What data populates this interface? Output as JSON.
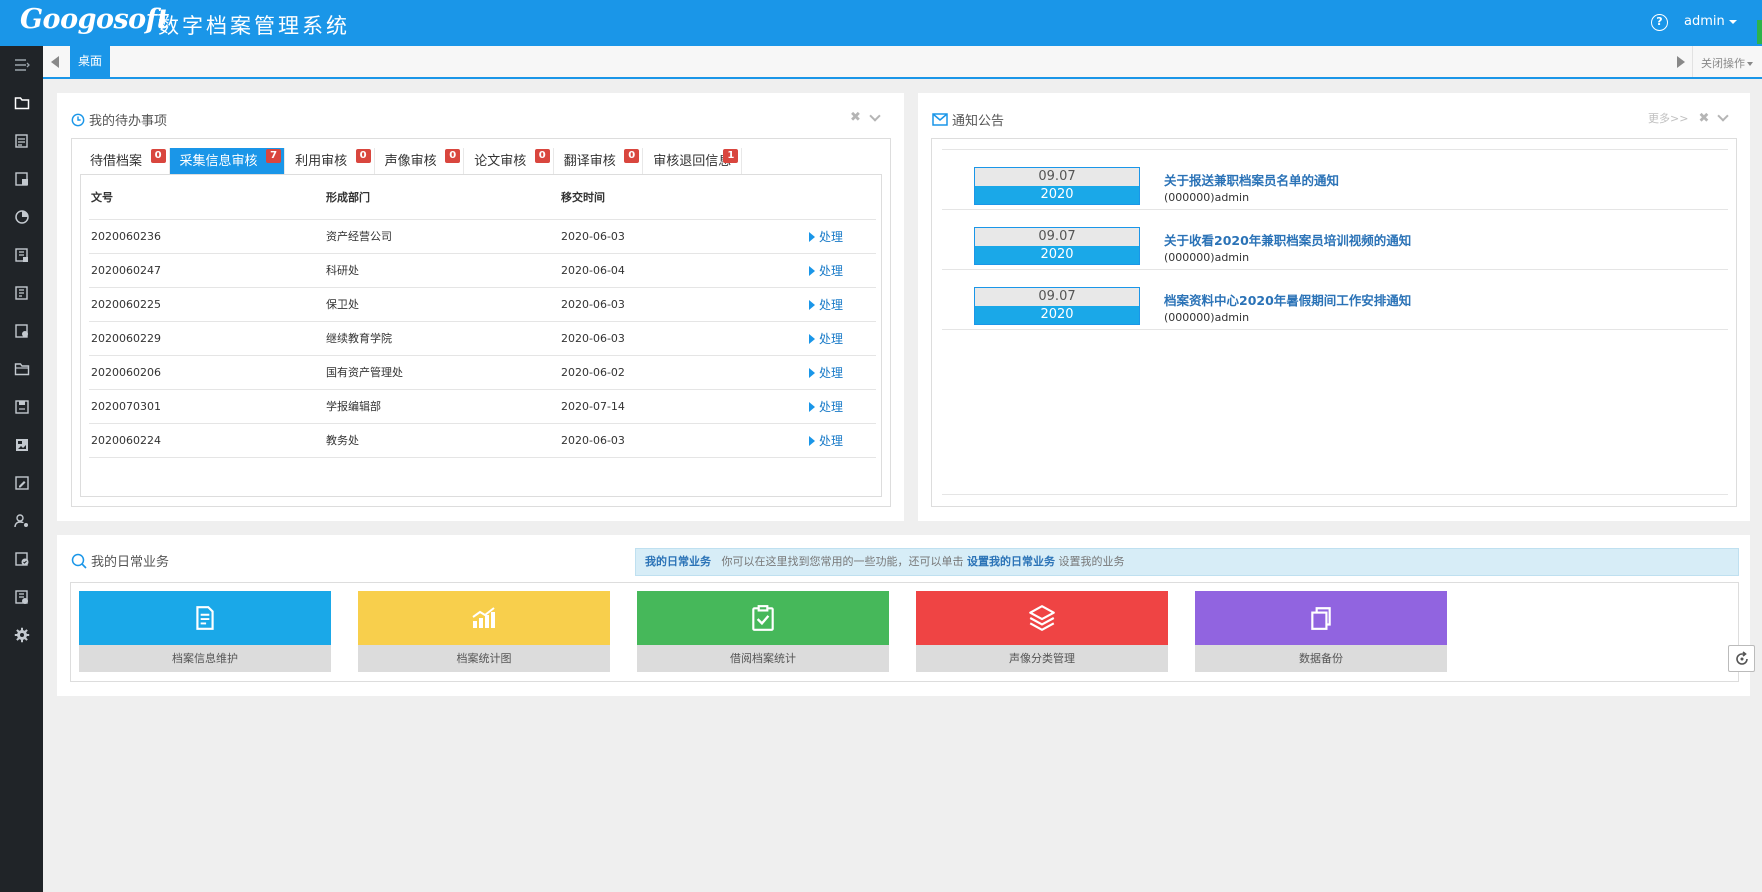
{
  "header": {
    "brand": "Googosoft",
    "system_name": "数字档案管理系统",
    "help_icon": "question-circle-icon",
    "user": "admin"
  },
  "tabbar": {
    "home_tab": "桌面",
    "close_ops": "关闭操作"
  },
  "todo": {
    "title": "我的待办事项",
    "tabs": [
      {
        "label": "待借档案",
        "count": "0"
      },
      {
        "label": "采集信息审核",
        "count": "7"
      },
      {
        "label": "利用审核",
        "count": "0"
      },
      {
        "label": "声像审核",
        "count": "0"
      },
      {
        "label": "论文审核",
        "count": "0"
      },
      {
        "label": "翻译审核",
        "count": "0"
      },
      {
        "label": "审核退回信息",
        "count": "1"
      }
    ],
    "active_tab": 1,
    "columns": {
      "doc_no": "文号",
      "dept": "形成部门",
      "time": "移交时间"
    },
    "rows": [
      {
        "doc_no": "2020060236",
        "dept": "资产经营公司",
        "time": "2020-06-03",
        "action": "处理"
      },
      {
        "doc_no": "2020060247",
        "dept": "科研处",
        "time": "2020-06-04",
        "action": "处理"
      },
      {
        "doc_no": "2020060225",
        "dept": "保卫处",
        "time": "2020-06-03",
        "action": "处理"
      },
      {
        "doc_no": "2020060229",
        "dept": "继续教育学院",
        "time": "2020-06-03",
        "action": "处理"
      },
      {
        "doc_no": "2020060206",
        "dept": "国有资产管理处",
        "time": "2020-06-02",
        "action": "处理"
      },
      {
        "doc_no": "2020070301",
        "dept": "学报编辑部",
        "time": "2020-07-14",
        "action": "处理"
      },
      {
        "doc_no": "2020060224",
        "dept": "教务处",
        "time": "2020-06-03",
        "action": "处理"
      }
    ]
  },
  "notice": {
    "title": "通知公告",
    "more": "更多>>",
    "items": [
      {
        "md": "09.07",
        "year": "2020",
        "title": "关于报送兼职档案员名单的通知",
        "author": "(000000)admin"
      },
      {
        "md": "09.07",
        "year": "2020",
        "title": "关于收看2020年兼职档案员培训视频的通知",
        "author": "(000000)admin"
      },
      {
        "md": "09.07",
        "year": "2020",
        "title": "档案资料中心2020年暑假期间工作安排通知",
        "author": "(000000)admin"
      }
    ]
  },
  "daily": {
    "title": "我的日常业务",
    "info_label": "我的日常业务",
    "info_text1": "你可以在这里找到您常用的一些功能，还可以单击",
    "info_link": "设置我的日常业务",
    "info_text2": "设置我的业务",
    "tiles": [
      {
        "label": "档案信息维护",
        "color": "#1aa8e8",
        "icon": "document-icon"
      },
      {
        "label": "档案统计图",
        "color": "#f8cf4c",
        "icon": "bar-chart-icon"
      },
      {
        "label": "借阅档案统计",
        "color": "#46b85a",
        "icon": "clipboard-check-icon"
      },
      {
        "label": "声像分类管理",
        "color": "#ef4444",
        "icon": "layers-icon"
      },
      {
        "label": "数据备份",
        "color": "#9164e0",
        "icon": "copy-icon"
      }
    ]
  },
  "sidebar": {
    "icons": [
      "menu-toggle-icon",
      "folder-icon",
      "calendar-doc-icon",
      "archive-doc-icon",
      "pie-chart-icon",
      "file-doc-icon",
      "file-list-icon",
      "stamp-doc-icon",
      "folder-open-icon",
      "save-doc-icon",
      "image-icon",
      "edit-doc-icon",
      "user-key-icon",
      "check-doc-icon",
      "task-doc-icon",
      "gear-icon"
    ]
  }
}
